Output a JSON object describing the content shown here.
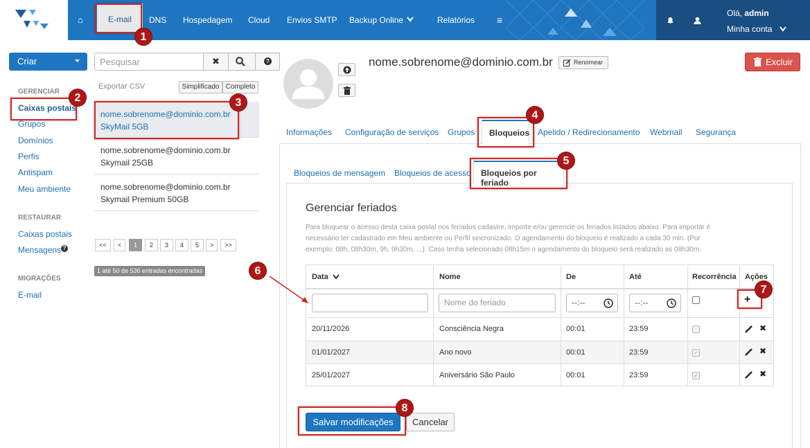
{
  "topnav": {
    "home": "⌂",
    "items": [
      "E-mail",
      "DNS",
      "Hospedagem",
      "Cloud",
      "Envios SMTP",
      "Backup Online",
      "Relatórios"
    ],
    "menu_icon": "≡",
    "greeting_prefix": "Olá, ",
    "user": "admin",
    "account": "Minha conta"
  },
  "colors": {
    "primary": "#1f76c0",
    "dark": "#1a4d80",
    "danger": "#d9534f",
    "callout": "#b01616"
  },
  "sidebar": {
    "create": "Criar",
    "sections": [
      {
        "title": "GERENCIAR",
        "items": [
          "Caixas postais",
          "Grupos",
          "Domínios",
          "Perfis",
          "Antispam",
          "Meu ambiente"
        ]
      },
      {
        "title": "RESTAURAR",
        "items": [
          "Caixas postais",
          "Mensagens"
        ]
      },
      {
        "title": "MIGRAÇÕES",
        "items": [
          "E-mail"
        ]
      }
    ]
  },
  "search": {
    "placeholder": "Pesquisar",
    "export": "Exportar CSV",
    "view_simple": "Simplificado",
    "view_full": "Completo"
  },
  "mailboxes": [
    {
      "email": "nome.sobrenome@dominio.com.br",
      "plan": "SkyMail 5GB"
    },
    {
      "email": "nome.sobrenome@dominio.com.br",
      "plan": "Skymail 25GB"
    },
    {
      "email": "nome.sobrenome@dominio.com.br",
      "plan": "Skymail Premium 50GB"
    }
  ],
  "pagination": {
    "pages": [
      "<<",
      "<",
      "1",
      "2",
      "3",
      "4",
      "5",
      ">",
      ">>"
    ],
    "summary": "1 até 50 de 536 entradas encontradas"
  },
  "detail": {
    "email": "nome.sobrenome@dominio.com.br",
    "rename": "Renomear",
    "delete": "Excluir",
    "tabs": [
      "Informações",
      "Configuração de serviços",
      "Grupos",
      "Bloqueios",
      "Apelido / Redirecionamento",
      "Webmail",
      "Segurança"
    ],
    "subtabs": [
      "Bloqueios de mensagem",
      "Bloqueios de acesso",
      "Bloqueios por feriado"
    ]
  },
  "holidays": {
    "title": "Gerenciar feriados",
    "help": [
      "Para bloquear o acesso desta caixa postal nos feriados cadastre, importe e/ou gerencie os feriados listados abaixo. Para importar é",
      "necessário ter cadastrado em Meu ambiente ou Perfil sincronizado. O agendamento do bloqueio é realizado a cada 30 min. (Por",
      "exemplo: 08h, 08h30m, 9h, 9h30m, ...). Caso tenha selecionado 08h15m o agendamento do bloqueio será realizado as 08h30m."
    ],
    "columns": [
      "Data",
      "Nome",
      "De",
      "Até",
      "Recorrência",
      "Ações"
    ],
    "name_placeholder": "Nome do feriado",
    "time_placeholder": "--:--",
    "rows": [
      {
        "date": "20/11/2026",
        "name": "Consciência Negra",
        "from": "00:01",
        "to": "23:59",
        "recurring": false
      },
      {
        "date": "01/01/2027",
        "name": "Ano novo",
        "from": "00:01",
        "to": "23:59",
        "recurring": true
      },
      {
        "date": "25/01/2027",
        "name": "Aniversário São Paulo",
        "from": "00:01",
        "to": "23:59",
        "recurring": true
      }
    ],
    "save": "Salvar modificações",
    "cancel": "Cancelar"
  },
  "callouts": [
    "1",
    "2",
    "3",
    "4",
    "5",
    "6",
    "7",
    "8"
  ]
}
